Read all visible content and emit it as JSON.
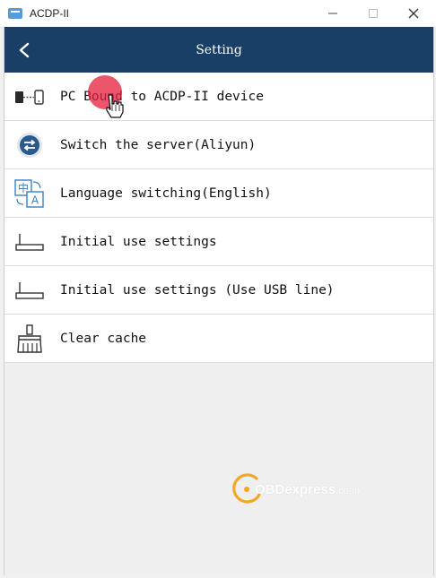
{
  "window": {
    "app_title": "ACDP-II"
  },
  "header": {
    "title": "Setting"
  },
  "settings": {
    "items": [
      {
        "label": "PC Bound to ACDP-II device",
        "icon": "device-bind-icon"
      },
      {
        "label": "Switch the server(Aliyun)",
        "icon": "server-switch-icon"
      },
      {
        "label": "Language switching(English)",
        "icon": "language-icon"
      },
      {
        "label": "Initial use settings",
        "icon": "router-icon"
      },
      {
        "label": "Initial use settings (Use USB line)",
        "icon": "router-usb-icon"
      },
      {
        "label": "Clear cache",
        "icon": "broom-icon"
      }
    ]
  },
  "watermark": {
    "brand": "OBDexpress",
    "domain": ".co.uk"
  },
  "colors": {
    "header_bg": "#1a3f66",
    "accent_orange": "#f5a623",
    "icon_blue": "#2b5a8a"
  }
}
